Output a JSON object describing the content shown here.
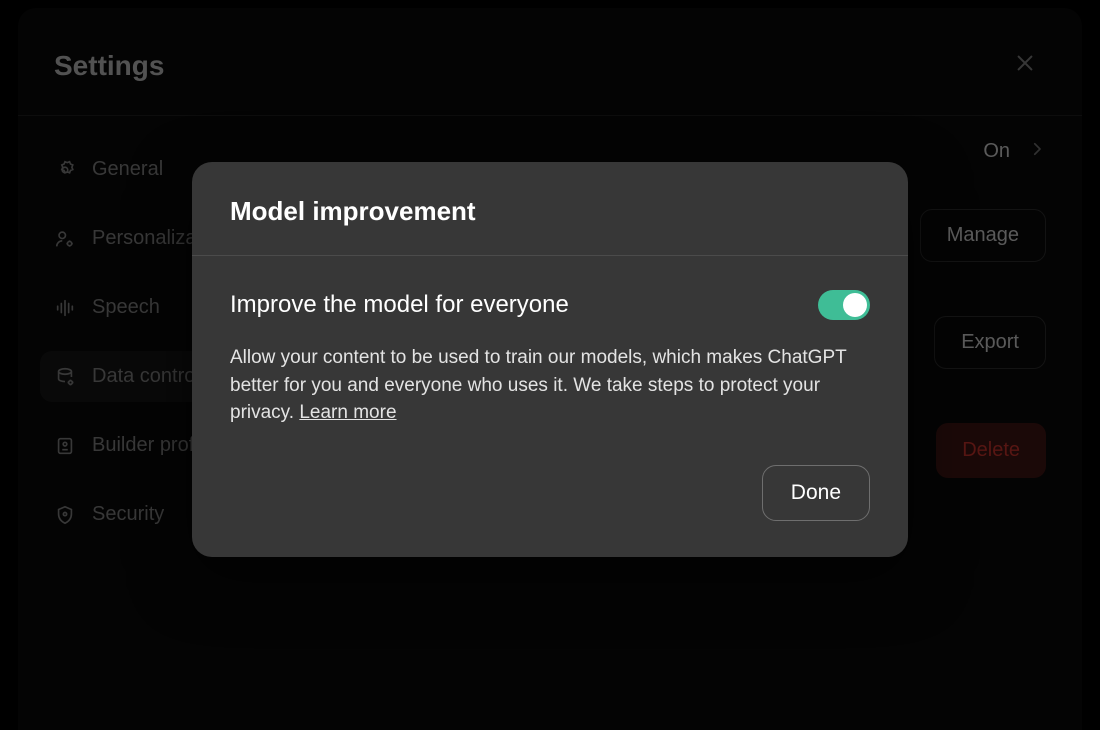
{
  "header": {
    "title": "Settings"
  },
  "sidebar": {
    "items": [
      {
        "label": "General"
      },
      {
        "label": "Personalization"
      },
      {
        "label": "Speech"
      },
      {
        "label": "Data controls"
      },
      {
        "label": "Builder profile"
      },
      {
        "label": "Security"
      }
    ]
  },
  "content": {
    "on_label": "On",
    "manage_label": "Manage",
    "export_label": "Export",
    "delete_label": "Delete"
  },
  "modal": {
    "title": "Model improvement",
    "toggle_label": "Improve the model for everyone",
    "toggle_on": true,
    "description": "Allow your content to be used to train our models, which makes ChatGPT better for you and everyone who uses it. We take steps to protect your privacy. ",
    "learn_more": "Learn more",
    "done_label": "Done"
  }
}
